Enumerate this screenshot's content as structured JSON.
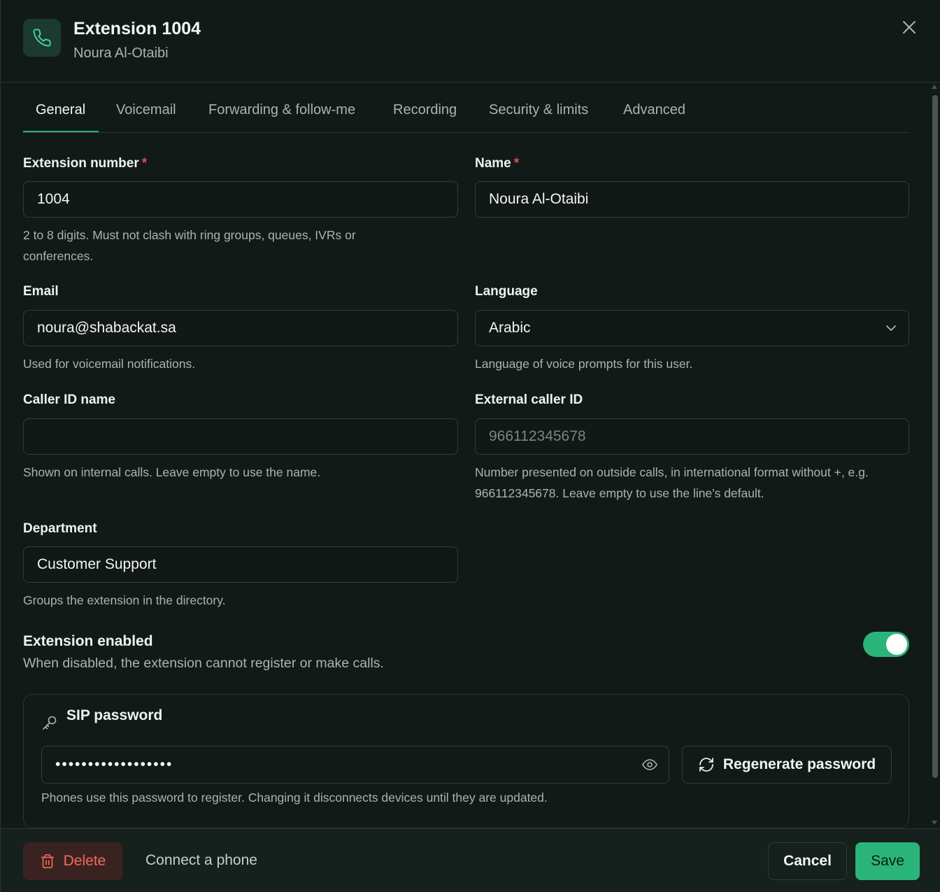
{
  "header": {
    "title": "Extension 1004",
    "subtitle": "Noura Al-Otaibi"
  },
  "tabs": [
    {
      "label": "General",
      "active": true
    },
    {
      "label": "Voicemail"
    },
    {
      "label": "Forwarding & follow-me"
    },
    {
      "label": "Recording"
    },
    {
      "label": "Security & limits"
    },
    {
      "label": "Advanced"
    }
  ],
  "form": {
    "required_mark": "*",
    "extension_number": {
      "label": "Extension number",
      "value": "1004",
      "help": "2 to 8 digits. Must not clash with ring groups, queues, IVRs or conferences."
    },
    "name": {
      "label": "Name",
      "value": "Noura Al-Otaibi"
    },
    "email": {
      "label": "Email",
      "value": "noura@shabackat.sa",
      "help": "Used for voicemail notifications."
    },
    "language": {
      "label": "Language",
      "value": "Arabic",
      "help": "Language of voice prompts for this user."
    },
    "caller_id_name": {
      "label": "Caller ID name",
      "value": "",
      "help": "Shown on internal calls. Leave empty to use the name."
    },
    "external_caller_id": {
      "label": "External caller ID",
      "placeholder": "966112345678",
      "help": "Number presented on outside calls, in international format without +, e.g. 966112345678. Leave empty to use the line's default."
    },
    "department": {
      "label": "Department",
      "value": "Customer Support",
      "help": "Groups the extension in the directory."
    },
    "enabled": {
      "label": "Extension enabled",
      "description": "When disabled, the extension cannot register or make calls.",
      "on": true
    }
  },
  "sip": {
    "title": "SIP password",
    "masked_value": "••••••••••••••••••",
    "regenerate_label": "Regenerate password",
    "help": "Phones use this password to register. Changing it disconnects devices until they are updated."
  },
  "footer": {
    "delete_label": "Delete",
    "connect_label": "Connect a phone",
    "cancel_label": "Cancel",
    "save_label": "Save"
  },
  "colors": {
    "accent": "#2bb47a",
    "danger": "#ef6a5e",
    "background": "#121a18"
  }
}
